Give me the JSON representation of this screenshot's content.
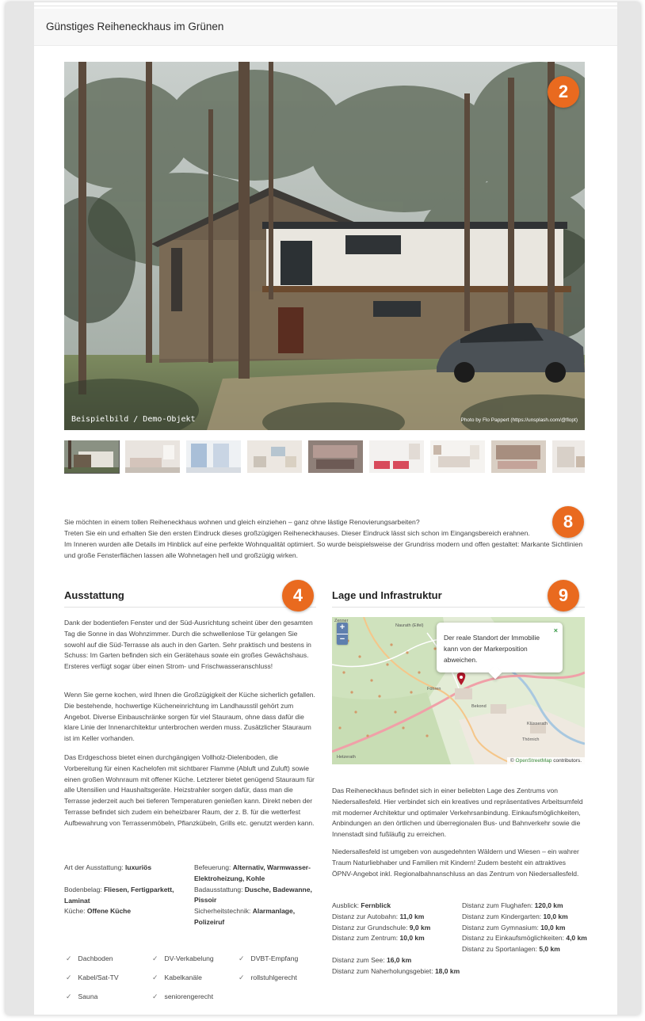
{
  "page": {
    "title": "Günstiges Reiheneckhaus im Grünen"
  },
  "hero": {
    "caption": "Beispielbild / Demo-Objekt",
    "credit": "Photo by Flo Pappert (https://unsplash.com/@flopt)",
    "badge": "2"
  },
  "intro": {
    "badge": "8",
    "lines": [
      "Sie möchten in einem tollen Reiheneckhaus wohnen und gleich einziehen – ganz ohne lästige Renovierungsarbeiten?",
      "Treten Sie ein und erhalten Sie den ersten Eindruck dieses großzügigen Reiheneckhauses. Dieser Eindruck lässt sich schon im Eingangsbereich erahnen.",
      "Im Inneren wurden alle Details im Hinblick auf eine perfekte Wohnqualität optimiert. So wurde beispielsweise der Grundriss modern und offen gestaltet: Markante Sichtlinien und große Fensterflächen lassen alle Wohnetagen hell und großzügig wirken."
    ]
  },
  "ausstattung": {
    "heading": "Ausstattung",
    "badge": "4",
    "p1": "Dank der bodentiefen Fenster und der Süd-Ausrichtung scheint über den gesamten Tag die Sonne in das Wohnzimmer. Durch die schwellenlose Tür gelangen Sie sowohl auf die Süd-Terrasse als auch in den Garten. Sehr praktisch und bestens in Schuss: Im Garten befinden sich ein Gerätehaus sowie ein großes Gewächshaus. Ersteres verfügt sogar über einen Strom- und Frischwasseranschluss!",
    "p2": "Wenn Sie gerne kochen, wird Ihnen die Großzügigkeit der Küche sicherlich gefallen. Die bestehende, hochwertige Kücheneinrichtung im Landhausstil gehört zum Angebot. Diverse Einbauschränke sorgen für viel Stauraum, ohne dass dafür die klare Linie der Innenarchitektur unterbrochen werden muss. Zusätzlicher Stauraum ist im Keller vorhanden.",
    "p3": "Das Erdgeschoss bietet einen durchgängigen Vollholz-Dielenboden, die Vorbereitung für einen Kachelofen mit sichtbarer Flamme (Abluft und Zuluft) sowie einen großen Wohnraum mit offener Küche. Letzterer bietet genügend Stauraum für alle Utensilien und Haushaltsgeräte. Heizstrahler sorgen dafür, dass man die Terrasse jederzeit auch bei tieferen Temperaturen genießen kann. Direkt neben der Terrasse befindet sich zudem ein beheizbarer Raum, der z. B. für die wetterfest Aufbewahrung von Terrassenmöbeln, Pflanzkübeln, Grills etc. genutzt werden kann.",
    "facts_left": [
      {
        "label": "Art der Ausstattung: ",
        "value": "luxuriös"
      },
      {
        "label": "Bodenbelag: ",
        "value": "Fliesen, Fertigparkett, Laminat"
      },
      {
        "label": "Küche: ",
        "value": "Offene Küche"
      }
    ],
    "facts_right": [
      {
        "label": "Befeuerung: ",
        "value": "Alternativ, Warmwasser-Elektroheizung, Kohle"
      },
      {
        "label": "Badausstattung: ",
        "value": "Dusche, Badewanne, Pissoir"
      },
      {
        "label": "Sicherheitstechnik: ",
        "value": "Alarmanlage, Polizeiruf"
      }
    ],
    "features": [
      "Dachboden",
      "DV-Verkabelung",
      "DVBT-Empfang",
      "Kabel/Sat-TV",
      "Kabelkanäle",
      "rollstuhlgerecht",
      "Sauna",
      "seniorengerecht"
    ],
    "check_glyph": "✓"
  },
  "lage": {
    "heading": "Lage und Infrastruktur",
    "badge": "9",
    "map": {
      "zoom_in": "+",
      "zoom_out": "−",
      "popup": "Der reale Standort der Immobilie kann von der Markerposition abweichen.",
      "popup_close": "×",
      "attribution_prefix": "© ",
      "attribution_link": "OpenStreetMap",
      "attribution_suffix": " contributors.",
      "places": [
        "Zenner",
        "Naurath (Eifel)",
        "Föhren",
        "Bekond",
        "Klüsserath",
        "Thörnich",
        "Hetzerath"
      ]
    },
    "p1": "Das Reiheneckhaus befindet sich in einer beliebten Lage des Zentrums von Niedersallesfeld. Hier verbindet sich ein kreatives und repräsentatives Arbeitsumfeld mit moderner Architektur und optimaler Verkehrsanbindung. Einkaufsmöglichkeiten, Anbindungen an den örtlichen und überregionalen Bus- und Bahnverkehr sowie die Innenstadt sind fußläufig zu erreichen.",
    "p2": "Niedersallesfeld ist umgeben von ausgedehnten Wäldern und Wiesen – ein wahrer Traum Naturliebhaber und Familien mit Kindern! Zudem besteht ein attraktives ÖPNV-Angebot inkl. Regionalbahnanschluss an das Zentrum von Niedersallesfeld.",
    "facts_left": [
      {
        "label": "Ausblick: ",
        "value": "Fernblick"
      },
      {
        "label": "Distanz zur Autobahn: ",
        "value": "11,0 km"
      },
      {
        "label": "Distanz zur Grundschule: ",
        "value": "9,0 km"
      },
      {
        "label": "Distanz zum Zentrum: ",
        "value": "10,0 km"
      },
      {
        "label": "Distanz zum See: ",
        "value": "16,0 km"
      },
      {
        "label": "Distanz zum Naherholungsgebiet: ",
        "value": "18,0 km"
      }
    ],
    "facts_right": [
      {
        "label": "Distanz zum Flughafen: ",
        "value": "120,0 km"
      },
      {
        "label": "Distanz zum Kindergarten: ",
        "value": "10,0 km"
      },
      {
        "label": "Distanz zum Gymnasium: ",
        "value": "10,0 km"
      },
      {
        "label": "Distanz zu Einkaufsmöglichkeiten: ",
        "value": "4,0 km"
      },
      {
        "label": "Distanz zu Sportanlagen: ",
        "value": "5,0 km"
      }
    ]
  }
}
